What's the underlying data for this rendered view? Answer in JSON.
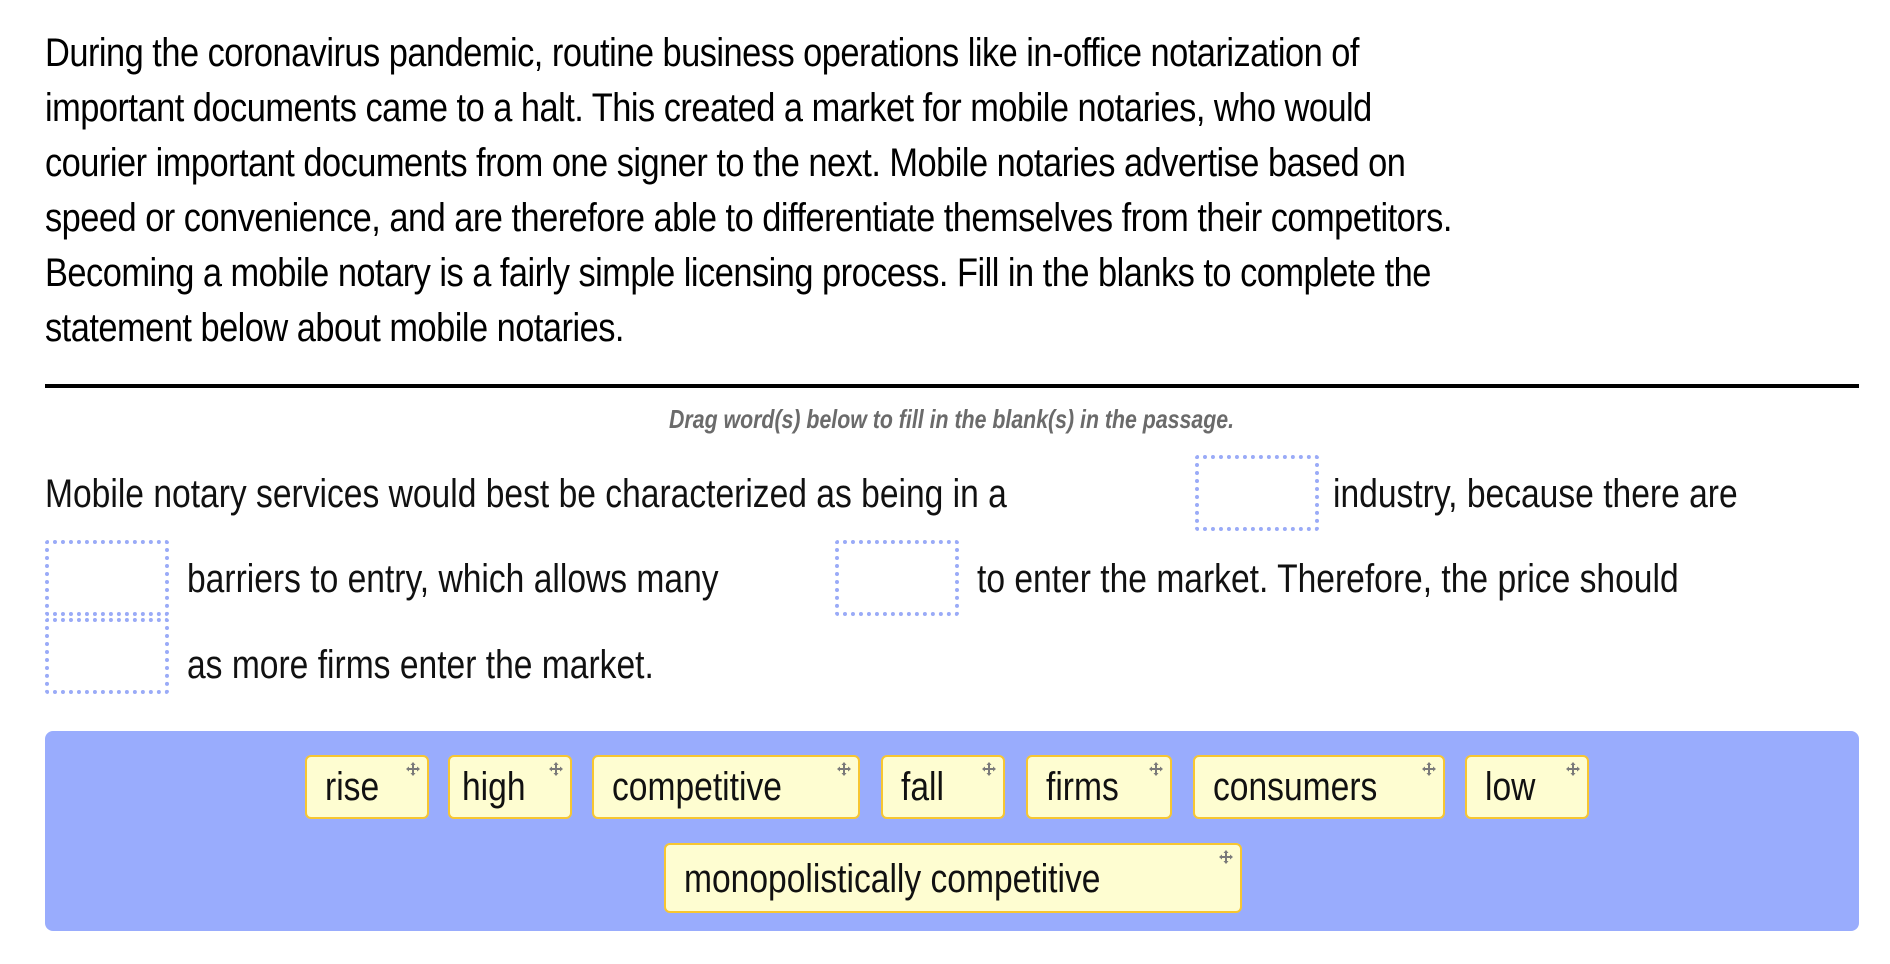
{
  "intro": {
    "lines": [
      "During the coronavirus pandemic, routine business operations like in-office notarization of",
      "important documents came to a halt. This created a market for mobile notaries, who would",
      "courier important documents from one signer to the next. Mobile notaries advertise based on",
      "speed or convenience, and are therefore able to differentiate themselves from their competitors.",
      "Becoming a mobile notary is a fairly simple licensing process. Fill in the blanks to complete the",
      "statement below about mobile notaries."
    ]
  },
  "instruction": "Drag word(s) below to fill in the blank(s) in the passage.",
  "passage": {
    "segments": [
      "Mobile notary services would best be characterized as being in a",
      "industry, because there are",
      "barriers to entry, which allows many",
      "to enter the market. Therefore, the price should",
      "as more firms enter the market."
    ],
    "blanks": [
      "",
      "",
      "",
      ""
    ]
  },
  "word_bank": {
    "words": [
      "rise",
      "high",
      "competitive",
      "fall",
      "firms",
      "consumers",
      "low",
      "monopolistically competitive"
    ],
    "drag_icon": "move-arrows-icon"
  },
  "colors": {
    "bank_bg": "#99acfd",
    "chip_bg": "#fefdd1",
    "chip_border": "#f7c631",
    "blank_border": "#9aabf7",
    "instruction_text": "#6b6b6b"
  }
}
